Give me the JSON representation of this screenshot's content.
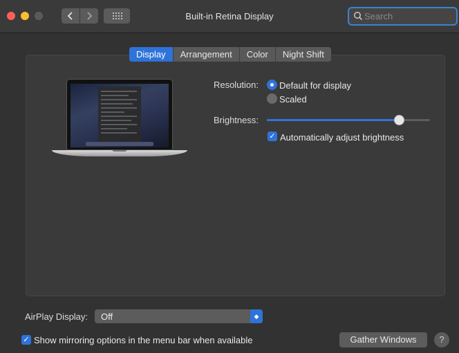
{
  "window": {
    "title": "Built-in Retina Display",
    "nav_back_icon": "chevron-left-icon",
    "nav_forward_icon": "chevron-right-icon",
    "grid_icon": "show-all-grid-icon"
  },
  "search": {
    "placeholder": "Search",
    "value": ""
  },
  "tabs": [
    {
      "label": "Display",
      "active": true
    },
    {
      "label": "Arrangement",
      "active": false
    },
    {
      "label": "Color",
      "active": false
    },
    {
      "label": "Night Shift",
      "active": false
    }
  ],
  "display": {
    "resolution_label": "Resolution:",
    "resolution_options": [
      {
        "label": "Default for display",
        "selected": true
      },
      {
        "label": "Scaled",
        "selected": false
      }
    ],
    "brightness_label": "Brightness:",
    "brightness_level": 0.81,
    "auto_brightness_label": "Automatically adjust brightness",
    "auto_brightness_checked": true
  },
  "footer": {
    "airplay_label": "AirPlay Display:",
    "airplay_value": "Off",
    "mirroring_label": "Show mirroring options in the menu bar when available",
    "mirroring_checked": true,
    "gather_label": "Gather Windows",
    "help_label": "?"
  },
  "colors": {
    "accent": "#2e73d9",
    "window_bg": "#323232"
  }
}
